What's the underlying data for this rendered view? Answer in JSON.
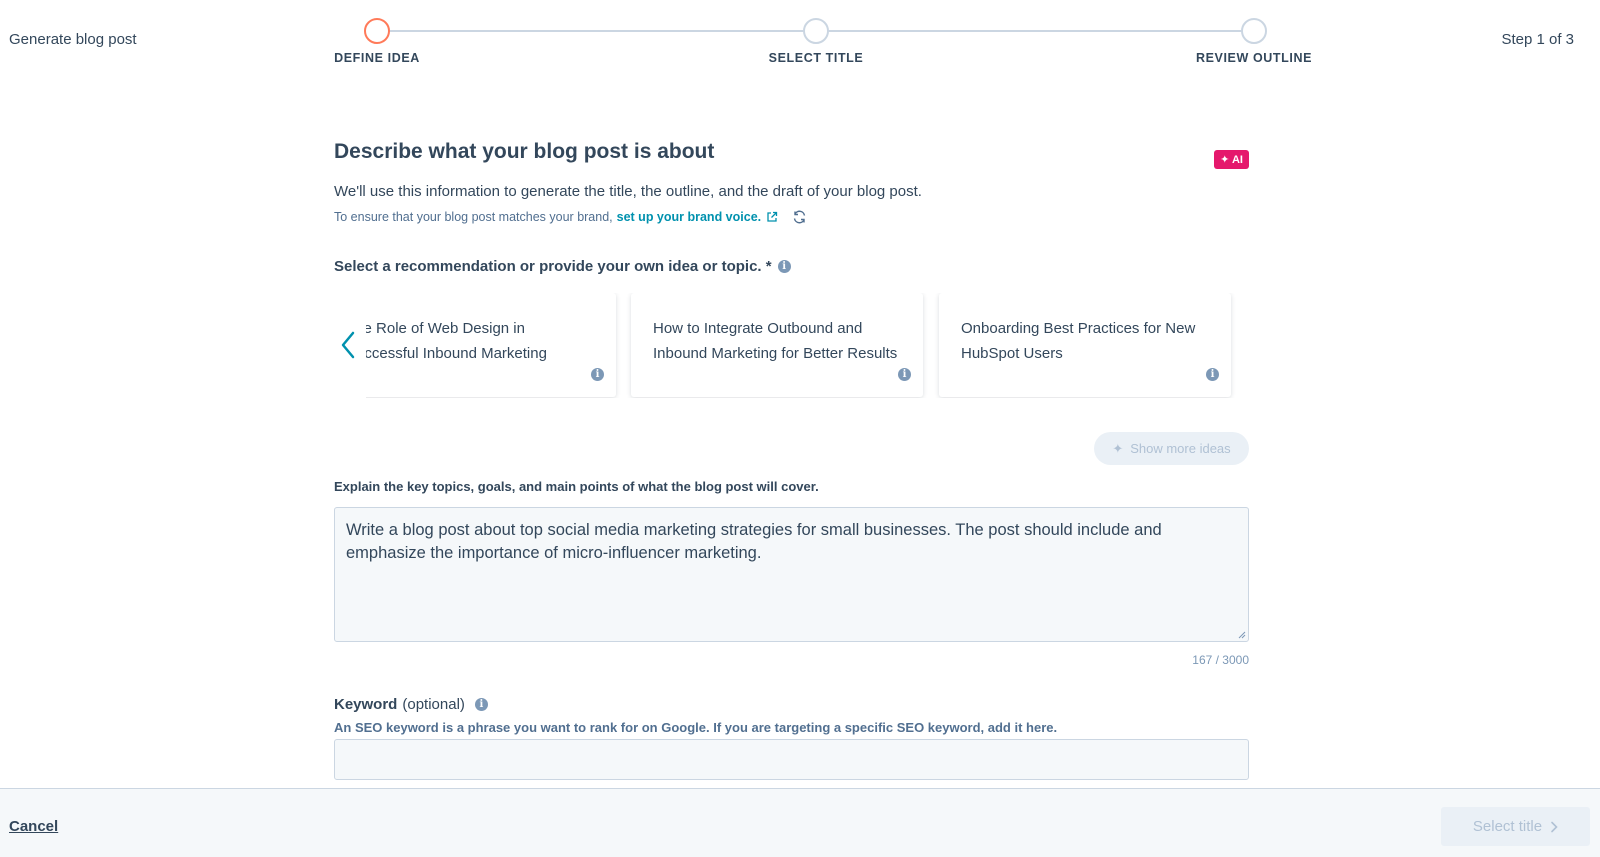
{
  "header": {
    "app_title": "Generate blog post",
    "step_count": "Step 1 of 3"
  },
  "stepper": {
    "steps": [
      {
        "label": "DEFINE IDEA",
        "state": "active"
      },
      {
        "label": "SELECT TITLE",
        "state": "upcoming"
      },
      {
        "label": "REVIEW OUTLINE",
        "state": "upcoming"
      }
    ],
    "active_color": "#ff7a59",
    "inactive_color": "#cbd6e2"
  },
  "main": {
    "heading": "Describe what your blog post is about",
    "ai_badge": "✦ AI",
    "subheading": "We'll use this information to generate the title, the outline, and the draft of your blog post.",
    "brand_prompt": "To ensure that your blog post matches your brand,",
    "brand_link": "set up your brand voice.",
    "recommendation_label": "Select a recommendation or provide your own idea or topic. *",
    "recommendations": [
      {
        "text": "The Role of Web Design in Successful Inbound Marketing Strategies"
      },
      {
        "text": "How to Integrate Outbound and Inbound Marketing for Better Results"
      },
      {
        "text": "Onboarding Best Practices for New HubSpot Users"
      }
    ],
    "show_more_ideas": "Show more ideas",
    "explain_label": "Explain the key topics, goals, and main points of what the blog post will cover.",
    "explain_value": "Write a blog post about top social media marketing strategies for small businesses. The post should include and emphasize the importance of micro-influencer marketing.",
    "char_counter": "167 / 3000",
    "keyword_label": "Keyword",
    "keyword_optional": "(optional)",
    "keyword_help": "An SEO keyword is a phrase you want to rank for on Google. If you are targeting a specific SEO keyword, add it here.",
    "keyword_value": ""
  },
  "footer": {
    "cancel_label": "Cancel",
    "next_label": "Select title"
  },
  "colors": {
    "accent_link": "#0091ae",
    "ai_badge": "#e5186c",
    "text": "#33475b",
    "disabled": "#b0c1d4"
  }
}
